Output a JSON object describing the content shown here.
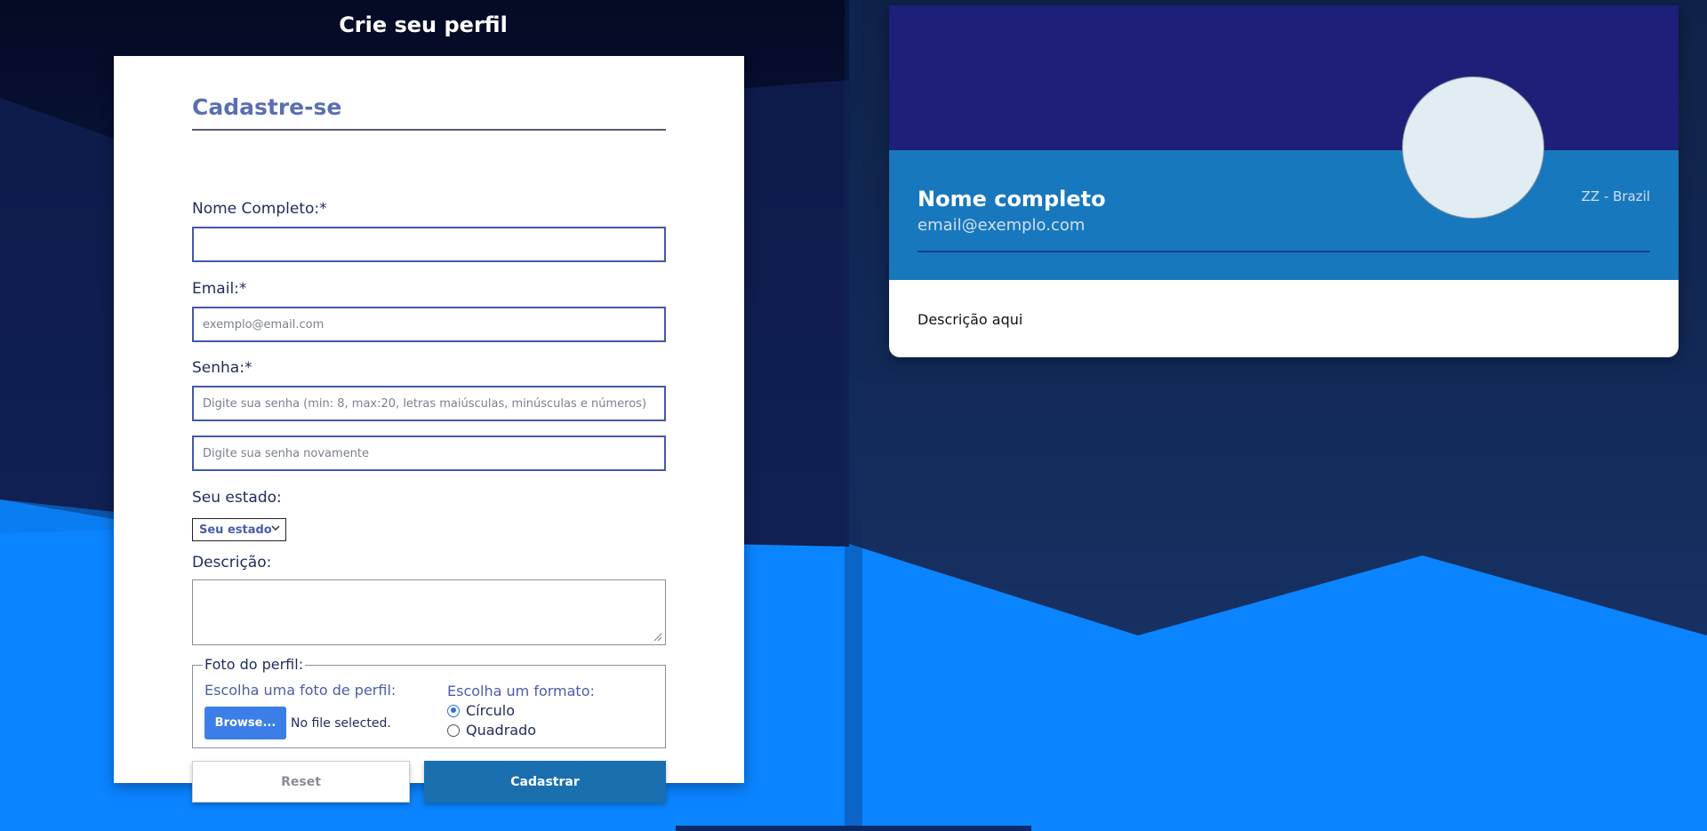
{
  "page": {
    "title": "Crie seu perfil"
  },
  "form": {
    "heading": "Cadastre-se",
    "name": {
      "label": "Nome Completo:*",
      "value": "",
      "placeholder": ""
    },
    "email": {
      "label": "Email:*",
      "value": "",
      "placeholder": "exemplo@email.com"
    },
    "password": {
      "label": "Senha:*",
      "value": "",
      "placeholder": "Digite sua senha (min: 8, max:20, letras maiúsculas, minúsculas e números)"
    },
    "password_confirm": {
      "value": "",
      "placeholder": "Digite sua senha novamente"
    },
    "state": {
      "label": "Seu estado:",
      "selected": "Seu estado"
    },
    "description": {
      "label": "Descrição:",
      "value": ""
    },
    "photo": {
      "legend": "Foto do perfil:",
      "choose_label": "Escolha uma foto de perfil:",
      "browse_label": "Browse...",
      "file_status": "No file selected.",
      "format_label": "Escolha um formato:",
      "options": [
        {
          "label": "Círculo",
          "checked": true
        },
        {
          "label": "Quadrado",
          "checked": false
        }
      ]
    },
    "reset_label": "Reset",
    "submit_label": "Cadastrar"
  },
  "preview": {
    "name": "Nome completo",
    "email": "email@exemplo.com",
    "location": "ZZ - Brazil",
    "description": "Descrição aqui"
  },
  "colors": {
    "background_dark": "#0a0f2e",
    "background_blue": "#0a84ff",
    "card_header": "#1d1f78",
    "card_band": "#1878bd",
    "accent_text": "#5b6fb0",
    "submit_button": "#1a6fae",
    "browse_button": "#3b7ee8"
  },
  "icons": {
    "select_chevron": "chevron-down-icon",
    "textarea_grip": "resize-grip-icon"
  }
}
